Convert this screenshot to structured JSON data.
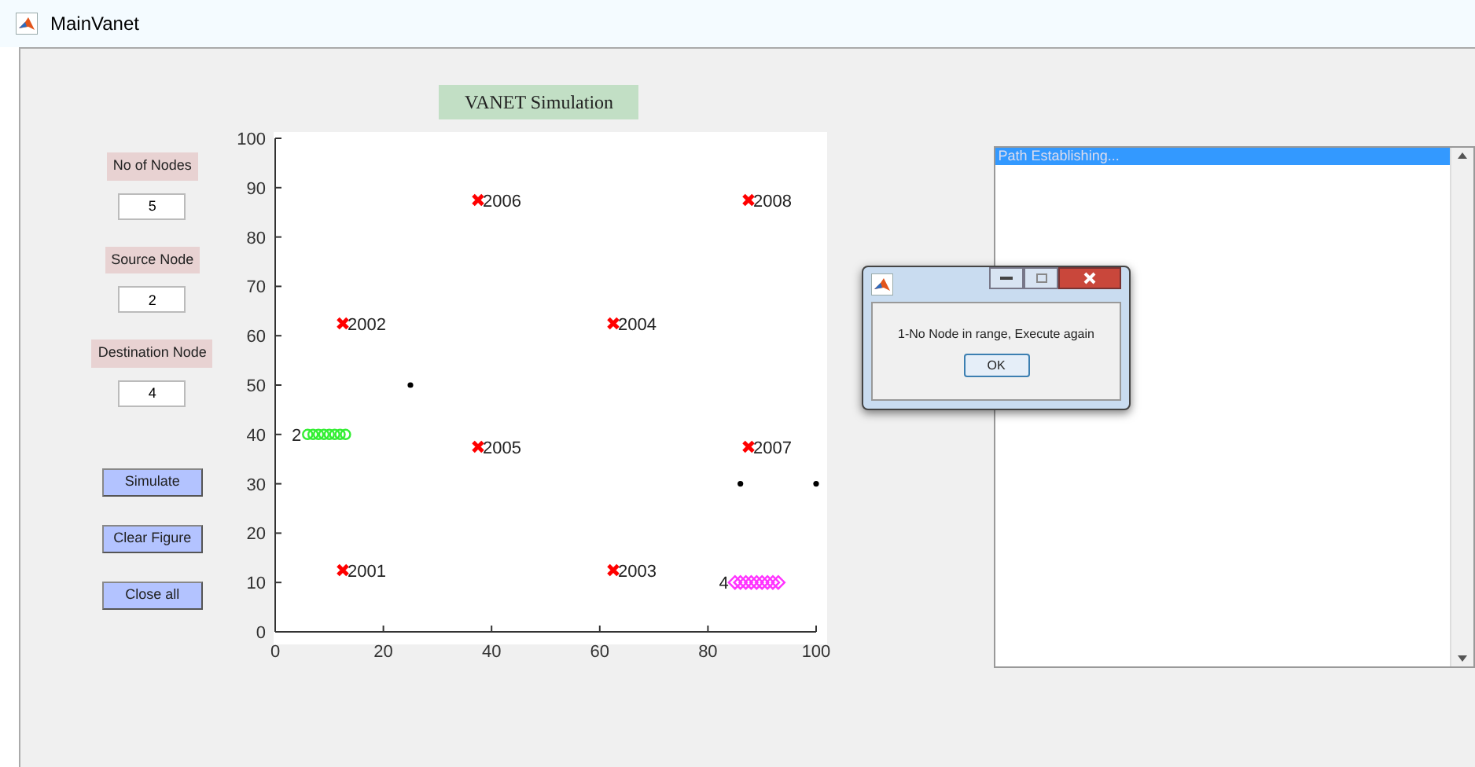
{
  "window": {
    "title": "MainVanet"
  },
  "inputs": [
    {
      "label": "No of Nodes",
      "value": "5"
    },
    {
      "label": "Source Node",
      "value": "2"
    },
    {
      "label": "Destination Node",
      "value": "4"
    }
  ],
  "buttons": [
    "Simulate",
    "Clear Figure",
    "Close all"
  ],
  "plot": {
    "title": "VANET Simulation",
    "chart_data": {
      "type": "scatter",
      "xlim": [
        0,
        100
      ],
      "ylim": [
        0,
        100
      ],
      "xticks": [
        0,
        20,
        40,
        60,
        80,
        100
      ],
      "yticks": [
        0,
        10,
        20,
        30,
        40,
        50,
        60,
        70,
        80,
        90,
        100
      ],
      "series": [
        {
          "color": "#ff0000",
          "x": [
            12.5,
            12.5,
            62.5,
            62.5,
            37.5,
            37.5,
            87.5,
            87.5
          ],
          "values": [
            12.5,
            62.5,
            12.5,
            62.5,
            37.5,
            87.5,
            37.5,
            87.5
          ]
        },
        {
          "color": "#33ee33",
          "x": [
            6,
            7,
            8,
            9,
            10,
            11,
            12,
            13
          ],
          "values": [
            40,
            40,
            40,
            40,
            40,
            40,
            40,
            40
          ]
        },
        {
          "color": "#ff33ff",
          "x": [
            85,
            86,
            87,
            88,
            89,
            90,
            91,
            92,
            93
          ],
          "values": [
            10,
            10,
            10,
            10,
            10,
            10,
            10,
            10,
            10
          ]
        },
        {
          "color": "#000000",
          "x": [
            25,
            86,
            100
          ],
          "values": [
            50,
            30,
            30
          ]
        }
      ],
      "annotations": [
        {
          "x": 12.5,
          "y": 12.5,
          "text": "2001"
        },
        {
          "x": 12.5,
          "y": 62.5,
          "text": "2002"
        },
        {
          "x": 62.5,
          "y": 12.5,
          "text": "2003"
        },
        {
          "x": 62.5,
          "y": 62.5,
          "text": "2004"
        },
        {
          "x": 37.5,
          "y": 37.5,
          "text": "2005"
        },
        {
          "x": 37.5,
          "y": 87.5,
          "text": "2006"
        },
        {
          "x": 87.5,
          "y": 37.5,
          "text": "2007"
        },
        {
          "x": 87.5,
          "y": 87.5,
          "text": "2008"
        },
        {
          "x": 6,
          "y": 40,
          "text": "2"
        },
        {
          "x": 85,
          "y": 10,
          "text": "4"
        }
      ]
    }
  },
  "listbox": {
    "items": [
      {
        "text": "Path Establishing...",
        "selected": true
      }
    ]
  },
  "dialog": {
    "message": "1-No Node in range, Execute again",
    "button": "OK"
  }
}
